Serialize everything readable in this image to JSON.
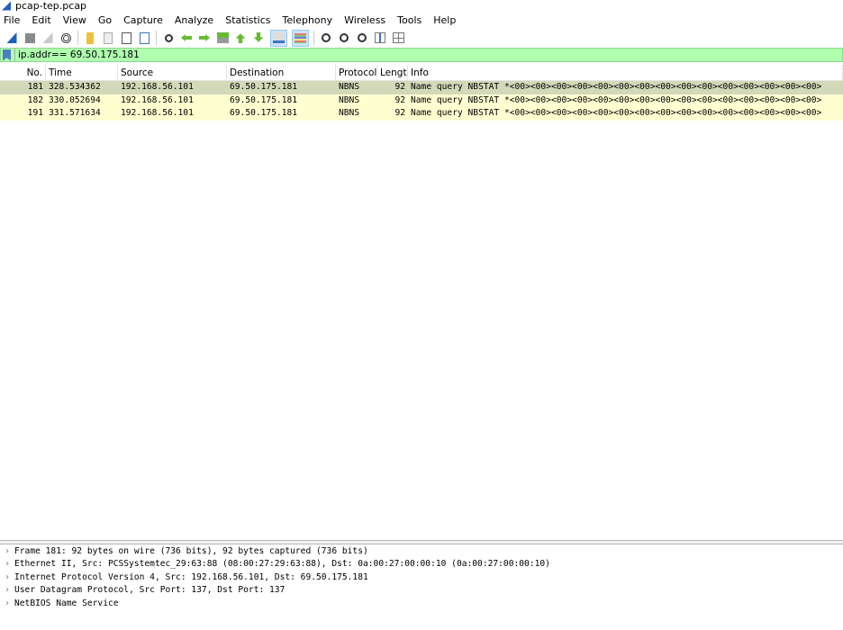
{
  "window": {
    "title": "pcap-tep.pcap"
  },
  "menu": [
    "File",
    "Edit",
    "View",
    "Go",
    "Capture",
    "Analyze",
    "Statistics",
    "Telephony",
    "Wireless",
    "Tools",
    "Help"
  ],
  "toolbar": [
    "start-capture-icon",
    "stop-capture-icon",
    "restart-capture-icon",
    "capture-options-icon",
    "|",
    "open-file-icon",
    "save-file-icon",
    "close-file-icon",
    "reload-file-icon",
    "|",
    "find-packet-icon",
    "go-back-icon",
    "go-forward-icon",
    "go-to-packet-icon",
    "go-first-icon",
    "go-last-icon",
    "autoscroll-icon",
    "colorize-icon",
    "|",
    "zoom-in-icon",
    "zoom-out-icon",
    "zoom-normal-icon",
    "resize-columns-icon",
    "layout-icon"
  ],
  "filter": {
    "value": "ip.addr== 69.50.175.181"
  },
  "columns": [
    "No.",
    "Time",
    "Source",
    "Destination",
    "Protocol",
    "Length",
    "Info"
  ],
  "packets": [
    {
      "no": "181",
      "time": "328.534362",
      "src": "192.168.56.101",
      "dst": "69.50.175.181",
      "proto": "NBNS",
      "len": "92",
      "info": "Name query NBSTAT *<00><00><00><00><00><00><00><00><00><00><00><00><00><00><00>",
      "selected": true
    },
    {
      "no": "182",
      "time": "330.052694",
      "src": "192.168.56.101",
      "dst": "69.50.175.181",
      "proto": "NBNS",
      "len": "92",
      "info": "Name query NBSTAT *<00><00><00><00><00><00><00><00><00><00><00><00><00><00><00>",
      "selected": false
    },
    {
      "no": "191",
      "time": "331.571634",
      "src": "192.168.56.101",
      "dst": "69.50.175.181",
      "proto": "NBNS",
      "len": "92",
      "info": "Name query NBSTAT *<00><00><00><00><00><00><00><00><00><00><00><00><00><00><00>",
      "selected": false
    }
  ],
  "details": [
    "Frame 181: 92 bytes on wire (736 bits), 92 bytes captured (736 bits)",
    "Ethernet II, Src: PCSSystemtec_29:63:88 (08:00:27:29:63:88), Dst: 0a:00:27:00:00:10 (0a:00:27:00:00:10)",
    "Internet Protocol Version 4, Src: 192.168.56.101, Dst: 69.50.175.181",
    "User Datagram Protocol, Src Port: 137, Dst Port: 137",
    "NetBIOS Name Service"
  ],
  "colors": {
    "filter_valid": "#afffaf",
    "row_bg": "#feffd0",
    "row_selected": "#d3d8b8"
  }
}
